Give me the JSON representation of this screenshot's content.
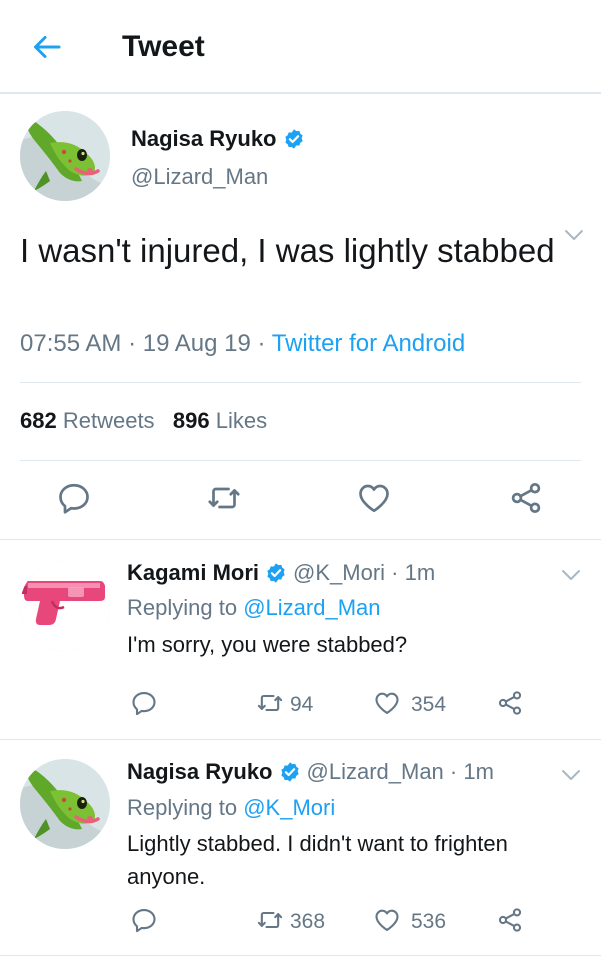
{
  "header": {
    "title": "Tweet"
  },
  "tweet": {
    "author": {
      "name": "Nagisa Ryuko",
      "handle": "@Lizard_Man"
    },
    "text": "I wasn't injured, I was lightly stabbed",
    "time": "07:55 AM",
    "date": "19 Aug 19",
    "source": "Twitter for Android",
    "retweets": "682",
    "retweets_label": "Retweets",
    "likes": "896",
    "likes_label": "Likes"
  },
  "replies": [
    {
      "name": "Kagami Mori",
      "handle": "@K_Mori",
      "time": "1m",
      "replying_prefix": "Replying to",
      "replying_to": "@Lizard_Man",
      "text": "I'm sorry, you were stabbed?",
      "retweets": "94",
      "likes": "354"
    },
    {
      "name": "Nagisa Ryuko",
      "handle": "@Lizard_Man",
      "time": "1m",
      "replying_prefix": "Replying to",
      "replying_to": "@K_Mori",
      "text": "Lightly stabbed. I didn't want to frighten anyone.",
      "retweets": "368",
      "likes": "536"
    }
  ],
  "colors": {
    "accent": "#1da1f2",
    "secondary_text": "#657786",
    "primary_text": "#14171a",
    "divider": "#e1e8ed"
  },
  "icons": [
    "back-arrow-icon",
    "verified-badge-icon",
    "chevron-down-icon",
    "reply-icon",
    "retweet-icon",
    "like-icon",
    "share-icon",
    "gecko-avatar",
    "water-pistol-avatar"
  ]
}
